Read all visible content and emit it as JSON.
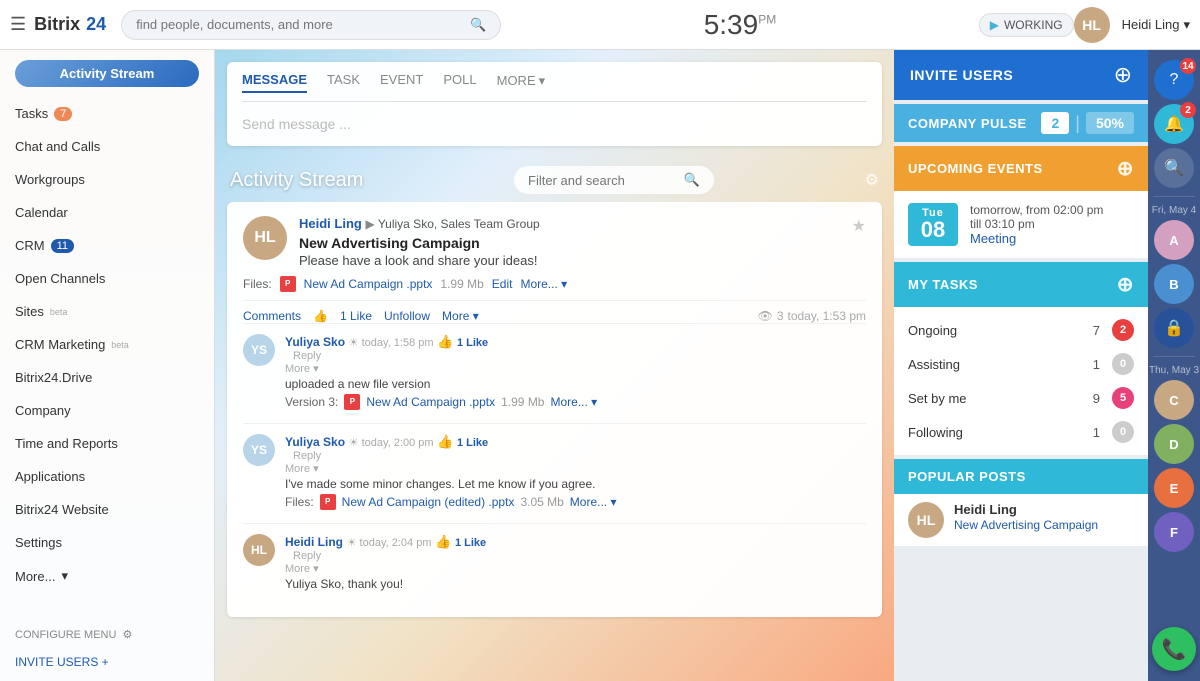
{
  "app": {
    "name": "Bitrix",
    "name_suffix": "24",
    "time": "5:39",
    "time_period": "PM",
    "status": "WORKING"
  },
  "topbar": {
    "search_placeholder": "find people, documents, and more",
    "user_name": "Heidi Ling",
    "user_initials": "HL"
  },
  "sidebar": {
    "activity_stream_label": "Activity Stream",
    "items": [
      {
        "label": "Tasks",
        "badge": "7",
        "badge_type": "normal"
      },
      {
        "label": "Chat and Calls",
        "badge": null
      },
      {
        "label": "Workgroups",
        "badge": null
      },
      {
        "label": "Calendar",
        "badge": null
      },
      {
        "label": "CRM",
        "badge": "11",
        "badge_type": "normal"
      },
      {
        "label": "Open Channels",
        "badge": null
      },
      {
        "label": "Sites",
        "suffix": "beta",
        "badge": null
      },
      {
        "label": "CRM Marketing",
        "suffix": "beta",
        "badge": null
      },
      {
        "label": "Bitrix24.Drive",
        "badge": null
      },
      {
        "label": "Company",
        "badge": null
      },
      {
        "label": "Time and Reports",
        "badge": null
      },
      {
        "label": "Applications",
        "badge": null
      },
      {
        "label": "Bitrix24 Website",
        "badge": null
      },
      {
        "label": "Settings",
        "badge": null
      },
      {
        "label": "More...",
        "badge": null
      }
    ],
    "configure_label": "CONFIGURE MENU",
    "invite_label": "INVITE USERS +"
  },
  "compose": {
    "tabs": [
      "MESSAGE",
      "TASK",
      "EVENT",
      "POLL"
    ],
    "more_label": "MORE",
    "active_tab": "MESSAGE",
    "placeholder": "Send message ..."
  },
  "stream": {
    "title": "Activity Stream",
    "search_placeholder": "Filter and search"
  },
  "posts": [
    {
      "id": 1,
      "author": "Heidi Ling",
      "author_initials": "HL",
      "target": "Yuliya Sko, Sales Team Group",
      "title": "New Advertising Campaign",
      "text": "Please have a look and share your ideas!",
      "files_label": "Files:",
      "file_name": "New Ad Campaign .pptx",
      "file_size": "1.99 Mb",
      "file_edit": "Edit",
      "file_more": "More...",
      "action_comments": "Comments",
      "action_like_count": "1 Like",
      "action_unfollow": "Unfollow",
      "action_more": "More",
      "views": "3",
      "timestamp": "today, 1:53 pm",
      "comments": [
        {
          "id": 1,
          "author": "Yuliya Sko",
          "author_initials": "YS",
          "time": "today, 1:58 pm",
          "like_count": "1 Like",
          "text": "uploaded a new file version",
          "version_label": "Version 3:",
          "file_name": "New Ad Campaign .pptx",
          "file_size": "1.99 Mb",
          "file_more": "More...",
          "actions": [
            "Like",
            "Reply",
            "More..."
          ]
        },
        {
          "id": 2,
          "author": "Yuliya Sko",
          "author_initials": "YS",
          "time": "today, 2:00 pm",
          "like_count": "1 Like",
          "text": "I've made some minor changes. Let me know if you agree.",
          "files_label": "Files:",
          "file_name": "New Ad Campaign (edited) .pptx",
          "file_size": "3.05 Mb",
          "file_more": "More...",
          "actions": [
            "Like",
            "Reply",
            "More..."
          ]
        },
        {
          "id": 3,
          "author": "Heidi Ling",
          "author_initials": "HL",
          "time": "today, 2:04 pm",
          "like_count": "1 Like",
          "text": "Yuliya Sko, thank you!",
          "actions": [
            "Like",
            "Reply",
            "More..."
          ]
        }
      ]
    }
  ],
  "right_sidebar": {
    "invite_users_label": "INVITE USERS",
    "company_pulse_label": "COMPANY PULSE",
    "pulse_count": "2",
    "pulse_pct": "50%",
    "upcoming_events_label": "UPCOMING EVENTS",
    "event": {
      "day_name": "Tue",
      "day_num": "08",
      "time_text": "tomorrow, from 02:00 pm",
      "time_end": "till 03:10 pm",
      "title": "Meeting"
    },
    "my_tasks_label": "MY TASKS",
    "tasks": [
      {
        "label": "Ongoing",
        "count": "7",
        "badge": "2",
        "badge_type": "red"
      },
      {
        "label": "Assisting",
        "count": "1",
        "badge": "0",
        "badge_type": "gray"
      },
      {
        "label": "Set by me",
        "count": "9",
        "badge": "5",
        "badge_type": "pink"
      },
      {
        "label": "Following",
        "count": "1",
        "badge": "0",
        "badge_type": "gray"
      }
    ],
    "popular_posts_label": "POPULAR POSTS",
    "popular_post": {
      "author": "Heidi Ling",
      "author_initials": "HL",
      "title": "New Advertising Campaign"
    }
  },
  "far_right": {
    "help_badge": "14",
    "notif_badge": "2",
    "date1": "Fri, May 4",
    "date2": "Thu, May 3",
    "avatars": [
      "A1",
      "A2",
      "A3",
      "A4",
      "A5",
      "A6"
    ]
  }
}
